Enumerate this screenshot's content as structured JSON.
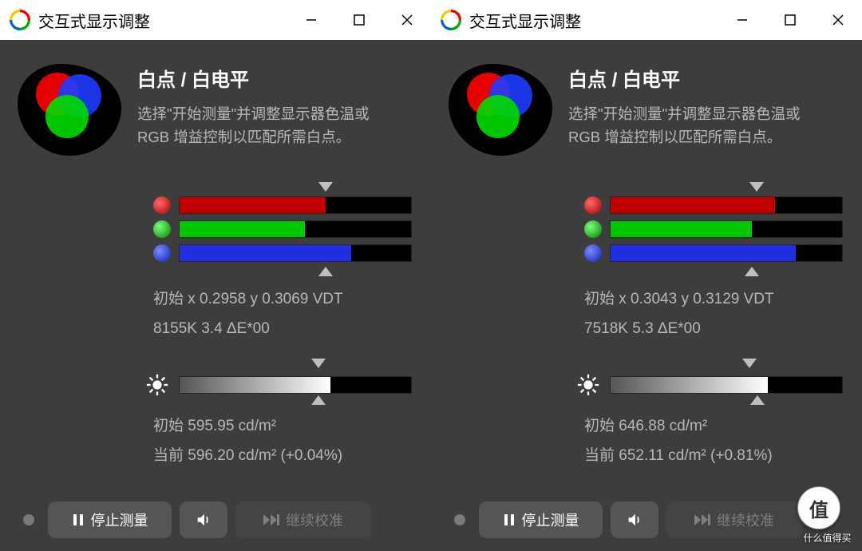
{
  "windows": [
    {
      "title": "交互式显示调整",
      "heading": "白点 / 白电平",
      "desc1": "选择\"开始测量\"并调整显示器色温或",
      "desc2": "RGB 增益控制以匹配所需白点。",
      "red_pct": 63,
      "green_pct": 54,
      "blue_pct": 74,
      "top_marker_pct": 63,
      "bot_marker_pct": 63,
      "readout1": "初始 x 0.2958 y 0.3069 VDT",
      "readout2": "8155K 3.4 ΔE*00",
      "bright_pct": 65,
      "bright_top_marker": 65,
      "bright_bot_marker": 65,
      "bright1": "初始 595.95 cd/m²",
      "bright2": "当前 596.20 cd/m² (+0.04%)",
      "stop_label": "停止测量",
      "continue_label": "继续校准"
    },
    {
      "title": "交互式显示调整",
      "heading": "白点 / 白电平",
      "desc1": "选择\"开始测量\"并调整显示器色温或",
      "desc2": "RGB 增益控制以匹配所需白点。",
      "red_pct": 71,
      "green_pct": 61,
      "blue_pct": 80,
      "top_marker_pct": 63,
      "bot_marker_pct": 61,
      "readout1": "初始 x 0.3043 y 0.3129 VDT",
      "readout2": "7518K 5.3 ΔE*00",
      "bright_pct": 68,
      "bright_top_marker": 65,
      "bright_bot_marker": 68,
      "bright1": "初始 646.88 cd/m²",
      "bright2": "当前 652.11 cd/m² (+0.81%)",
      "stop_label": "停止测量",
      "continue_label": "继续校准"
    }
  ],
  "watermark": {
    "char": "值",
    "text": "什么值得买"
  },
  "colors": {
    "red": "#c00000",
    "green": "#00c800",
    "blue": "#2030e0"
  }
}
